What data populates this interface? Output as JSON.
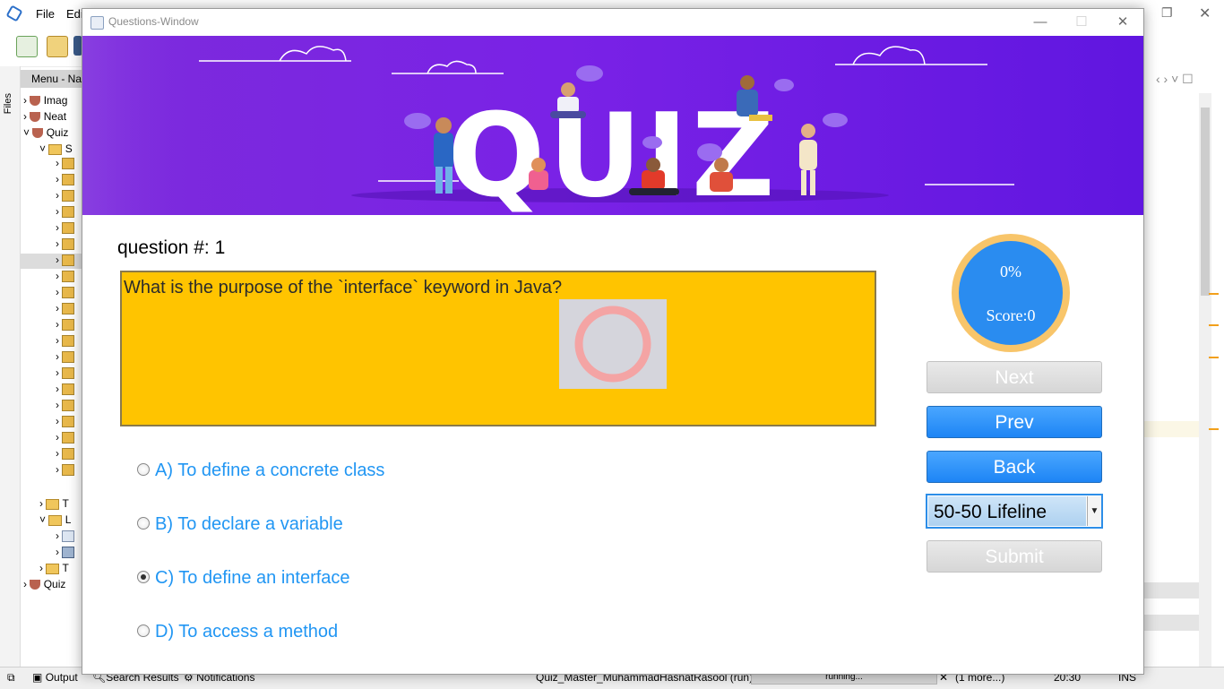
{
  "ide": {
    "menus": [
      "File",
      "Edi"
    ],
    "project_header": "Menu - Na",
    "files_tab": "Files",
    "tree": [
      {
        "label": "Imag",
        "icon": "coffee-cup-icon"
      },
      {
        "label": "Neat",
        "icon": "coffee-cup-icon"
      },
      {
        "label": "Quiz",
        "icon": "coffee-cup-icon"
      },
      {
        "label": "S",
        "icon": "folder-icon"
      },
      {
        "label": "T",
        "icon": "folder-icon"
      },
      {
        "label": "L",
        "icon": "folder-icon"
      },
      {
        "label": "T",
        "icon": "folder-icon"
      },
      {
        "label": "Quiz",
        "icon": "coffee-cup-icon"
      }
    ],
    "status": {
      "output": "Output",
      "search_results": "Search Results",
      "notifications": "Notifications",
      "run_label": "Quiz_Master_MuhammadHasnatRasool (run)",
      "progress_text": "running...",
      "more": "(1 more...)",
      "position": "20:30",
      "mode": "INS"
    }
  },
  "dialog": {
    "title": "Questions-Window",
    "banner_title": "QUIZ",
    "question_number": "question #: 1",
    "question_text": "What is the purpose of the `interface` keyword in Java?",
    "options": [
      {
        "label": "A) To define a concrete class",
        "selected": false
      },
      {
        "label": "B) To declare a variable",
        "selected": false
      },
      {
        "label": "C) To define an interface",
        "selected": true
      },
      {
        "label": "D) To access a method",
        "selected": false
      }
    ],
    "progress": {
      "percent_label": "0%",
      "score_label": "Score:0"
    },
    "buttons": {
      "next": "Next",
      "prev": "Prev",
      "back": "Back",
      "submit": "Submit"
    },
    "lifeline": {
      "selected": "50-50 Lifeline"
    },
    "colors": {
      "banner": "#7a22e6",
      "question_box": "#ffc400",
      "option_text": "#2196f3",
      "button_active": "#1d85f5",
      "gauge_ring": "#f8c56a",
      "gauge_fill": "#2a8cf0"
    }
  }
}
